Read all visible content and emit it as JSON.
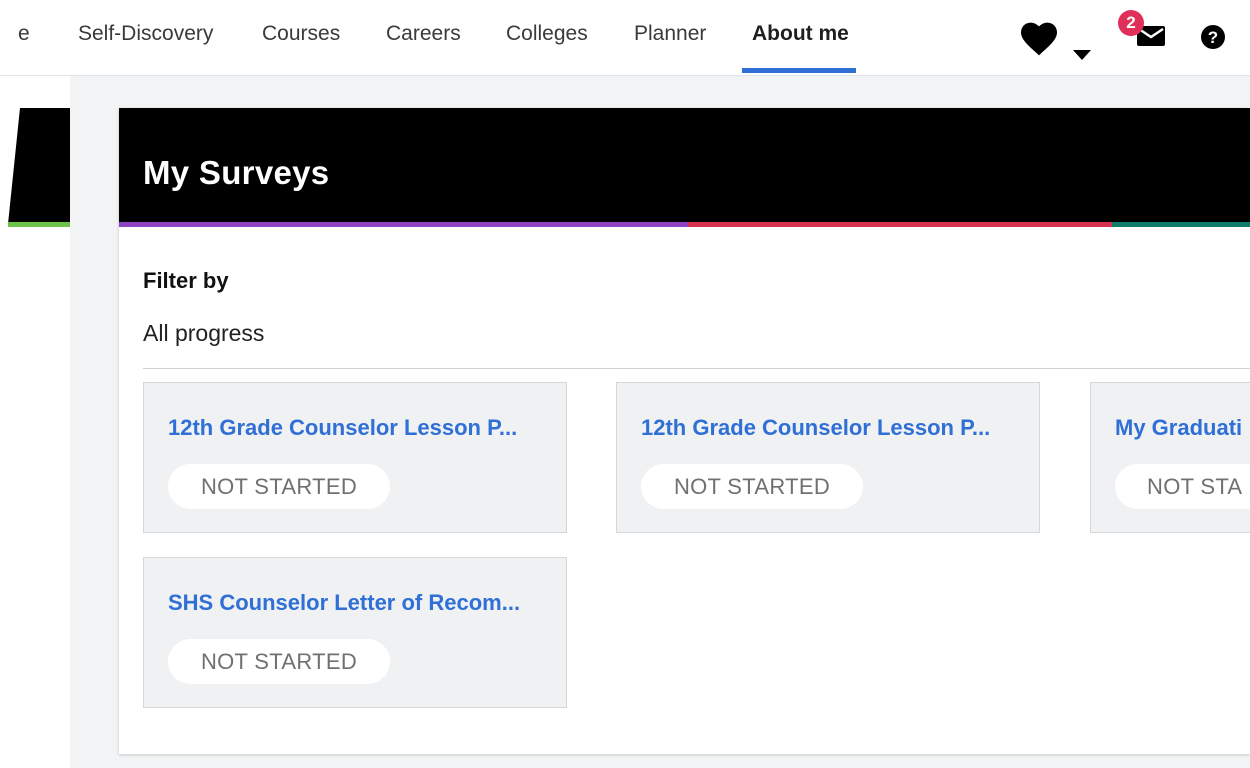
{
  "nav": {
    "partial_item": "e",
    "items": [
      {
        "label": "Self-Discovery"
      },
      {
        "label": "Courses"
      },
      {
        "label": "Careers"
      },
      {
        "label": "Colleges"
      },
      {
        "label": "Planner"
      },
      {
        "label": "About me"
      }
    ],
    "active": "About me",
    "accent_color": "#2f6fd6",
    "icons": [
      "heart-icon",
      "caret-down-icon",
      "mail-icon",
      "help-icon"
    ],
    "mail_badge_count": "2"
  },
  "card": {
    "title": "My Surveys",
    "stripe_colors": [
      "#8e44c4",
      "#d8314f",
      "#0e7d6a"
    ],
    "filter": {
      "label": "Filter by",
      "value": "All progress"
    },
    "surveys": [
      {
        "title": "12th Grade Counselor Lesson P...",
        "status": "NOT STARTED"
      },
      {
        "title": "12th Grade Counselor Lesson P...",
        "status": "NOT STARTED"
      },
      {
        "title": "My Graduati",
        "status": "NOT STA"
      },
      {
        "title": "SHS Counselor Letter of Recom...",
        "status": "NOT STARTED"
      }
    ]
  }
}
